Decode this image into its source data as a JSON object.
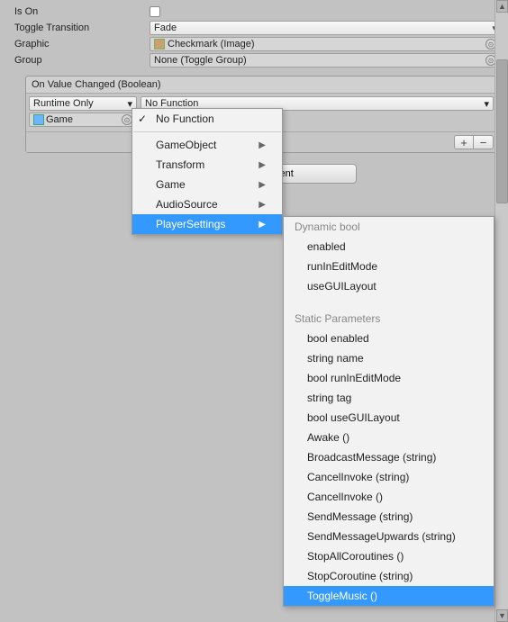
{
  "props": {
    "isOn": {
      "label": "Is On"
    },
    "toggleTransition": {
      "label": "Toggle Transition",
      "value": "Fade"
    },
    "graphic": {
      "label": "Graphic",
      "value": "Checkmark (Image)"
    },
    "group": {
      "label": "Group",
      "value": "None (Toggle Group)"
    }
  },
  "event": {
    "title": "On Value Changed (Boolean)",
    "runtime": "Runtime Only",
    "function": "No Function",
    "target": "Game",
    "plus": "+",
    "minus": "−"
  },
  "addComponent": "Add Component",
  "menu1": {
    "items": [
      {
        "label": "No Function",
        "checked": true
      },
      {
        "label": "GameObject",
        "sub": true
      },
      {
        "label": "Transform",
        "sub": true
      },
      {
        "label": "Game",
        "sub": true
      },
      {
        "label": "AudioSource",
        "sub": true
      },
      {
        "label": "PlayerSettings",
        "sub": true,
        "hover": true
      }
    ]
  },
  "menu2": {
    "header1": "Dynamic bool",
    "group1": [
      "enabled",
      "runInEditMode",
      "useGUILayout"
    ],
    "header2": "Static Parameters",
    "group2": [
      "bool enabled",
      "string name",
      "bool runInEditMode",
      "string tag",
      "bool useGUILayout",
      "Awake ()",
      "BroadcastMessage (string)",
      "CancelInvoke (string)",
      "CancelInvoke ()",
      "SendMessage (string)",
      "SendMessageUpwards (string)",
      "StopAllCoroutines ()",
      "StopCoroutine (string)",
      "ToggleMusic ()"
    ],
    "hoverIndex": 13
  }
}
